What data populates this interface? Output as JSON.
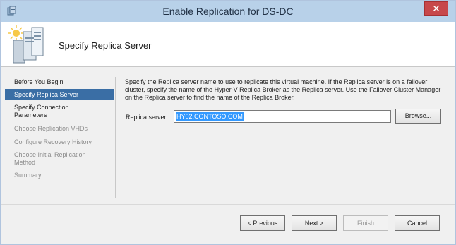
{
  "window": {
    "title": "Enable Replication for  DS-DC",
    "close_glyph": "✕"
  },
  "header": {
    "title": "Specify Replica Server",
    "icon": "server-wizard-icon"
  },
  "sidebar": {
    "items": [
      {
        "label": "Before You Begin",
        "state": "done"
      },
      {
        "label": "Specify Replica Server",
        "state": "active"
      },
      {
        "label": "Specify Connection Parameters",
        "state": "pending"
      },
      {
        "label": "Choose Replication VHDs",
        "state": "pending"
      },
      {
        "label": "Configure Recovery History",
        "state": "pending"
      },
      {
        "label": "Choose Initial Replication Method",
        "state": "pending"
      },
      {
        "label": "Summary",
        "state": "pending"
      }
    ]
  },
  "main": {
    "description": "Specify the Replica server name to use to replicate this virtual machine. If the Replica server is on a failover cluster, specify the name of the Hyper-V Replica Broker as the Replica server. Use the Failover Cluster Manager on the Replica server to find the name of the Replica Broker.",
    "replica_label": "Replica server:",
    "replica_value": "HY02.CONTOSO.COM",
    "browse_label": "Browse..."
  },
  "footer": {
    "previous_label": "< Previous",
    "next_label": "Next >",
    "finish_label": "Finish",
    "cancel_label": "Cancel"
  },
  "colors": {
    "titlebar": "#b8d1e9",
    "active_nav": "#3a6ea5",
    "selection": "#3399ff",
    "close_button": "#c7474a"
  }
}
